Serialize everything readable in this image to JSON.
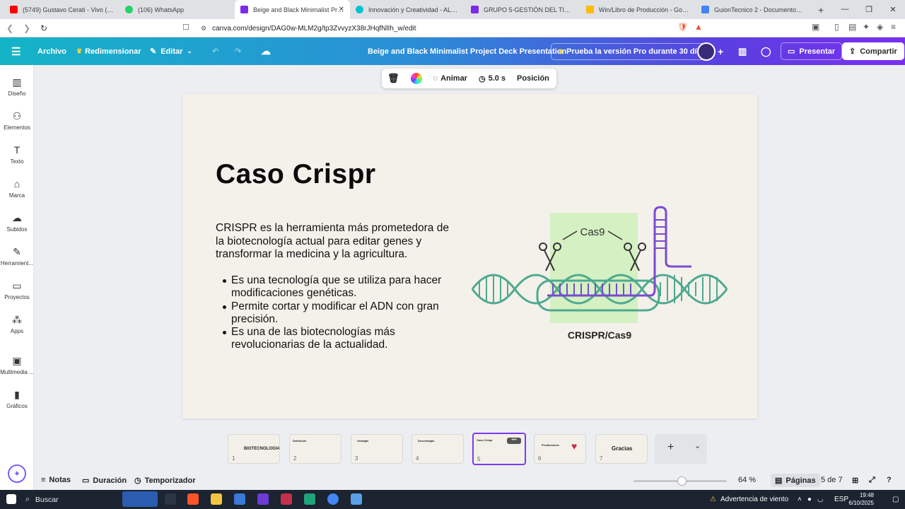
{
  "browser": {
    "tabs": [
      {
        "label": "(5749) Gustavo Cerati - Vivo (Officia",
        "icon": "youtube-icon",
        "color": "#ff0000"
      },
      {
        "label": "(106) WhatsApp",
        "icon": "whatsapp-icon",
        "color": "#25d366"
      },
      {
        "label": "Beige and Black Minimalist Proje",
        "icon": "canva-icon",
        "color": "#7d2ae8",
        "active": true
      },
      {
        "label": "Innovación y Creatividad - ALUMNO",
        "icon": "canva-icon",
        "color": "#00c4cc"
      },
      {
        "label": "GRUPO 5-GESTIÓN DEL TIEMPO - P",
        "icon": "canva-icon",
        "color": "#7d2ae8"
      },
      {
        "label": "Win/Libro de Producción - Google D",
        "icon": "docs-icon",
        "color": "#fbbc04"
      },
      {
        "label": "GuionTecnico 2 - Documentos de G",
        "icon": "docs-icon",
        "color": "#4285f4"
      }
    ],
    "url": "canva.com/design/DAG0w-MLM2g/tp3ZvvyzX38rJHqfNlIh_w/edit"
  },
  "header": {
    "menu": "Archivo",
    "resize": "Redimensionar",
    "edit": "Editar",
    "doc_title": "Beige and Black Minimalist Project Deck Presentation",
    "pro_trial": "Prueba la versión Pro durante 30 días",
    "present": "Presentar",
    "share": "Compartir"
  },
  "sidebar": {
    "items": [
      {
        "label": "Diseño",
        "icon": "layout-icon"
      },
      {
        "label": "Elementos",
        "icon": "shapes-icon"
      },
      {
        "label": "Texto",
        "icon": "text-icon"
      },
      {
        "label": "Marca",
        "icon": "brand-icon"
      },
      {
        "label": "Subidos",
        "icon": "upload-icon"
      },
      {
        "label": "Herramient...",
        "icon": "pen-tool-icon"
      },
      {
        "label": "Proyectos",
        "icon": "folder-icon"
      },
      {
        "label": "Apps",
        "icon": "apps-icon"
      },
      {
        "label": "Multimedia ...",
        "icon": "media-icon"
      },
      {
        "label": "Gráficos",
        "icon": "chart-icon"
      }
    ]
  },
  "context_toolbar": {
    "animate": "Animar",
    "duration": "5.0 s",
    "position": "Posición"
  },
  "slide": {
    "title": "Caso Crispr",
    "paragraph": "CRISPR es la herramienta más prometedora de la biotecnología actual para editar genes y transformar la medicina y la agricultura.",
    "bullets": [
      "Es una tecnología que se utiliza para hacer modificaciones genéticas.",
      "Permite cortar y modificar el ADN con gran precisión.",
      "Es una de las biotecnologías más revolucionarias de la actualidad."
    ],
    "figure_label": "Cas9",
    "figure_caption": "CRISPR/Cas9"
  },
  "pages": [
    {
      "num": "1",
      "title": "BIOTECNOLOGIA"
    },
    {
      "num": "2",
      "title": "Definición"
    },
    {
      "num": "3",
      "title": "Ventajas"
    },
    {
      "num": "4",
      "title": "Desventajas"
    },
    {
      "num": "5",
      "title": "Caso Crispr",
      "selected": true
    },
    {
      "num": "6",
      "title": "Predicciones"
    },
    {
      "num": "7",
      "title": "Gracias"
    }
  ],
  "bottombar": {
    "notes": "Notas",
    "duration": "Duración",
    "timer": "Temporizador",
    "zoom": "64 %",
    "zoom_level": 0.64,
    "pages": "Páginas",
    "page_counter": "5 de 7"
  },
  "taskbar": {
    "search": "Buscar",
    "weather": "Advertencia de viento",
    "lang": "ESP",
    "time": "19:48",
    "date": "6/10/2025"
  }
}
